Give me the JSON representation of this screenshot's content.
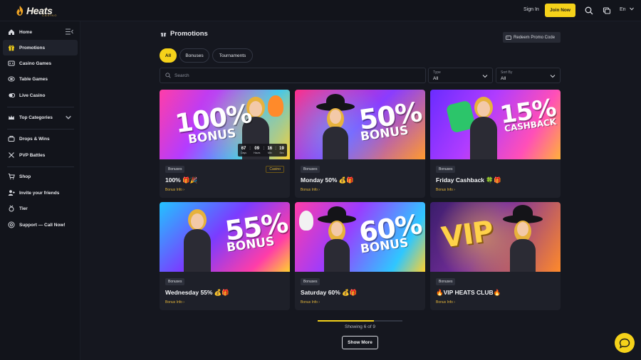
{
  "header": {
    "logo_text": "Heats",
    "logo_sub": "CASINO",
    "signin_label": "Sign In",
    "join_label": "Join Now",
    "language": "En"
  },
  "sidebar": {
    "items": [
      {
        "label": "Home",
        "icon": "home-icon"
      },
      {
        "label": "Promotions",
        "icon": "gift-icon",
        "active": true
      },
      {
        "label": "Casino Games",
        "icon": "slots-icon"
      },
      {
        "label": "Table Games",
        "icon": "table-icon"
      },
      {
        "label": "Live Casino",
        "icon": "live-icon"
      },
      {
        "label": "Top Categories",
        "icon": "crown-icon"
      },
      {
        "label": "Drops & Wins",
        "icon": "drop-icon"
      },
      {
        "label": "PVP Battles",
        "icon": "swords-icon"
      },
      {
        "label": "Shop",
        "icon": "cart-icon"
      },
      {
        "label": "Invite your friends",
        "icon": "invite-icon"
      },
      {
        "label": "Tier",
        "icon": "tier-icon"
      },
      {
        "label": "Support — Call Now!",
        "icon": "support-icon"
      }
    ]
  },
  "main": {
    "title": "Promotions",
    "redeem_label": "Redeem Promo Code",
    "tabs": [
      {
        "label": "All",
        "active": true
      },
      {
        "label": "Bonuses"
      },
      {
        "label": "Tournaments"
      }
    ],
    "search_placeholder": "Search",
    "filters": [
      {
        "label": "Type",
        "value": "All"
      },
      {
        "label": "Sort By",
        "value": "All"
      }
    ],
    "cards": [
      {
        "tag": "Bonuses",
        "tag2": "Casino",
        "title": "100% 🎁🎉",
        "info": "Bonus Info",
        "banner_text": "100%",
        "banner_word": "BONUS",
        "timer": {
          "days": "67",
          "hours": "09",
          "min": "16",
          "sec": "19",
          "days_label": "Days",
          "hours_label": "Hours",
          "min_label": "Min",
          "sec_label": "Sec"
        }
      },
      {
        "tag": "Bonuses",
        "title": "Monday 50% 💰🎁",
        "info": "Bonus Info",
        "banner_text": "50%",
        "banner_word": "BONUS"
      },
      {
        "tag": "Bonuses",
        "title": "Friday Cashback 🍀🎁",
        "info": "Bonus Info",
        "banner_text": "15%",
        "banner_word": "CASHBACK"
      },
      {
        "tag": "Bonuses",
        "title": "Wednesday 55% 💰🎁",
        "info": "Bonus Info",
        "banner_text": "55%",
        "banner_word": "BONUS"
      },
      {
        "tag": "Bonuses",
        "title": "Saturday 60% 💰🎁",
        "info": "Bonus Info",
        "banner_text": "60%",
        "banner_word": "BONUS"
      },
      {
        "tag": "Bonuses",
        "title": "🔥VIP HEATS CLUB🔥",
        "info": "Bonus Info",
        "banner_text": "VIP",
        "banner_word": ""
      }
    ],
    "showing_text": "Showing 6 of 9",
    "progress": 0.667,
    "show_more_label": "Show More"
  },
  "colors": {
    "accent": "#f5d21a",
    "background": "#15171f",
    "sidebar": "#12141b",
    "card": "#1e2029"
  }
}
